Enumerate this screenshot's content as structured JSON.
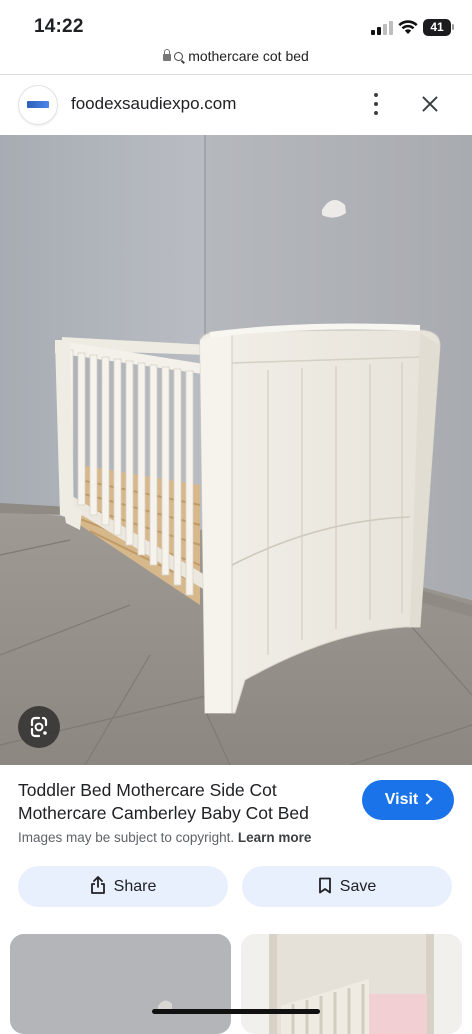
{
  "status_bar": {
    "time": "14:22",
    "battery": "41"
  },
  "browser": {
    "url_text": "mothercare cot bed"
  },
  "source": {
    "name": "foodexsaudiexpo.com",
    "icons": [
      "more-vert-icon",
      "close-icon"
    ]
  },
  "result": {
    "title_line1": "Toddler Bed Mothercare Side Cot",
    "title_line2": "Mothercare Camberley Baby Cot Bed",
    "visit_label": "Visit",
    "copyright_text": "Images may be subject to copyright.",
    "learn_more_label": "Learn more"
  },
  "actions": {
    "share_label": "Share",
    "save_label": "Save"
  },
  "colors": {
    "accent": "#1a73e8",
    "chip_bg": "#e8f0fe"
  }
}
